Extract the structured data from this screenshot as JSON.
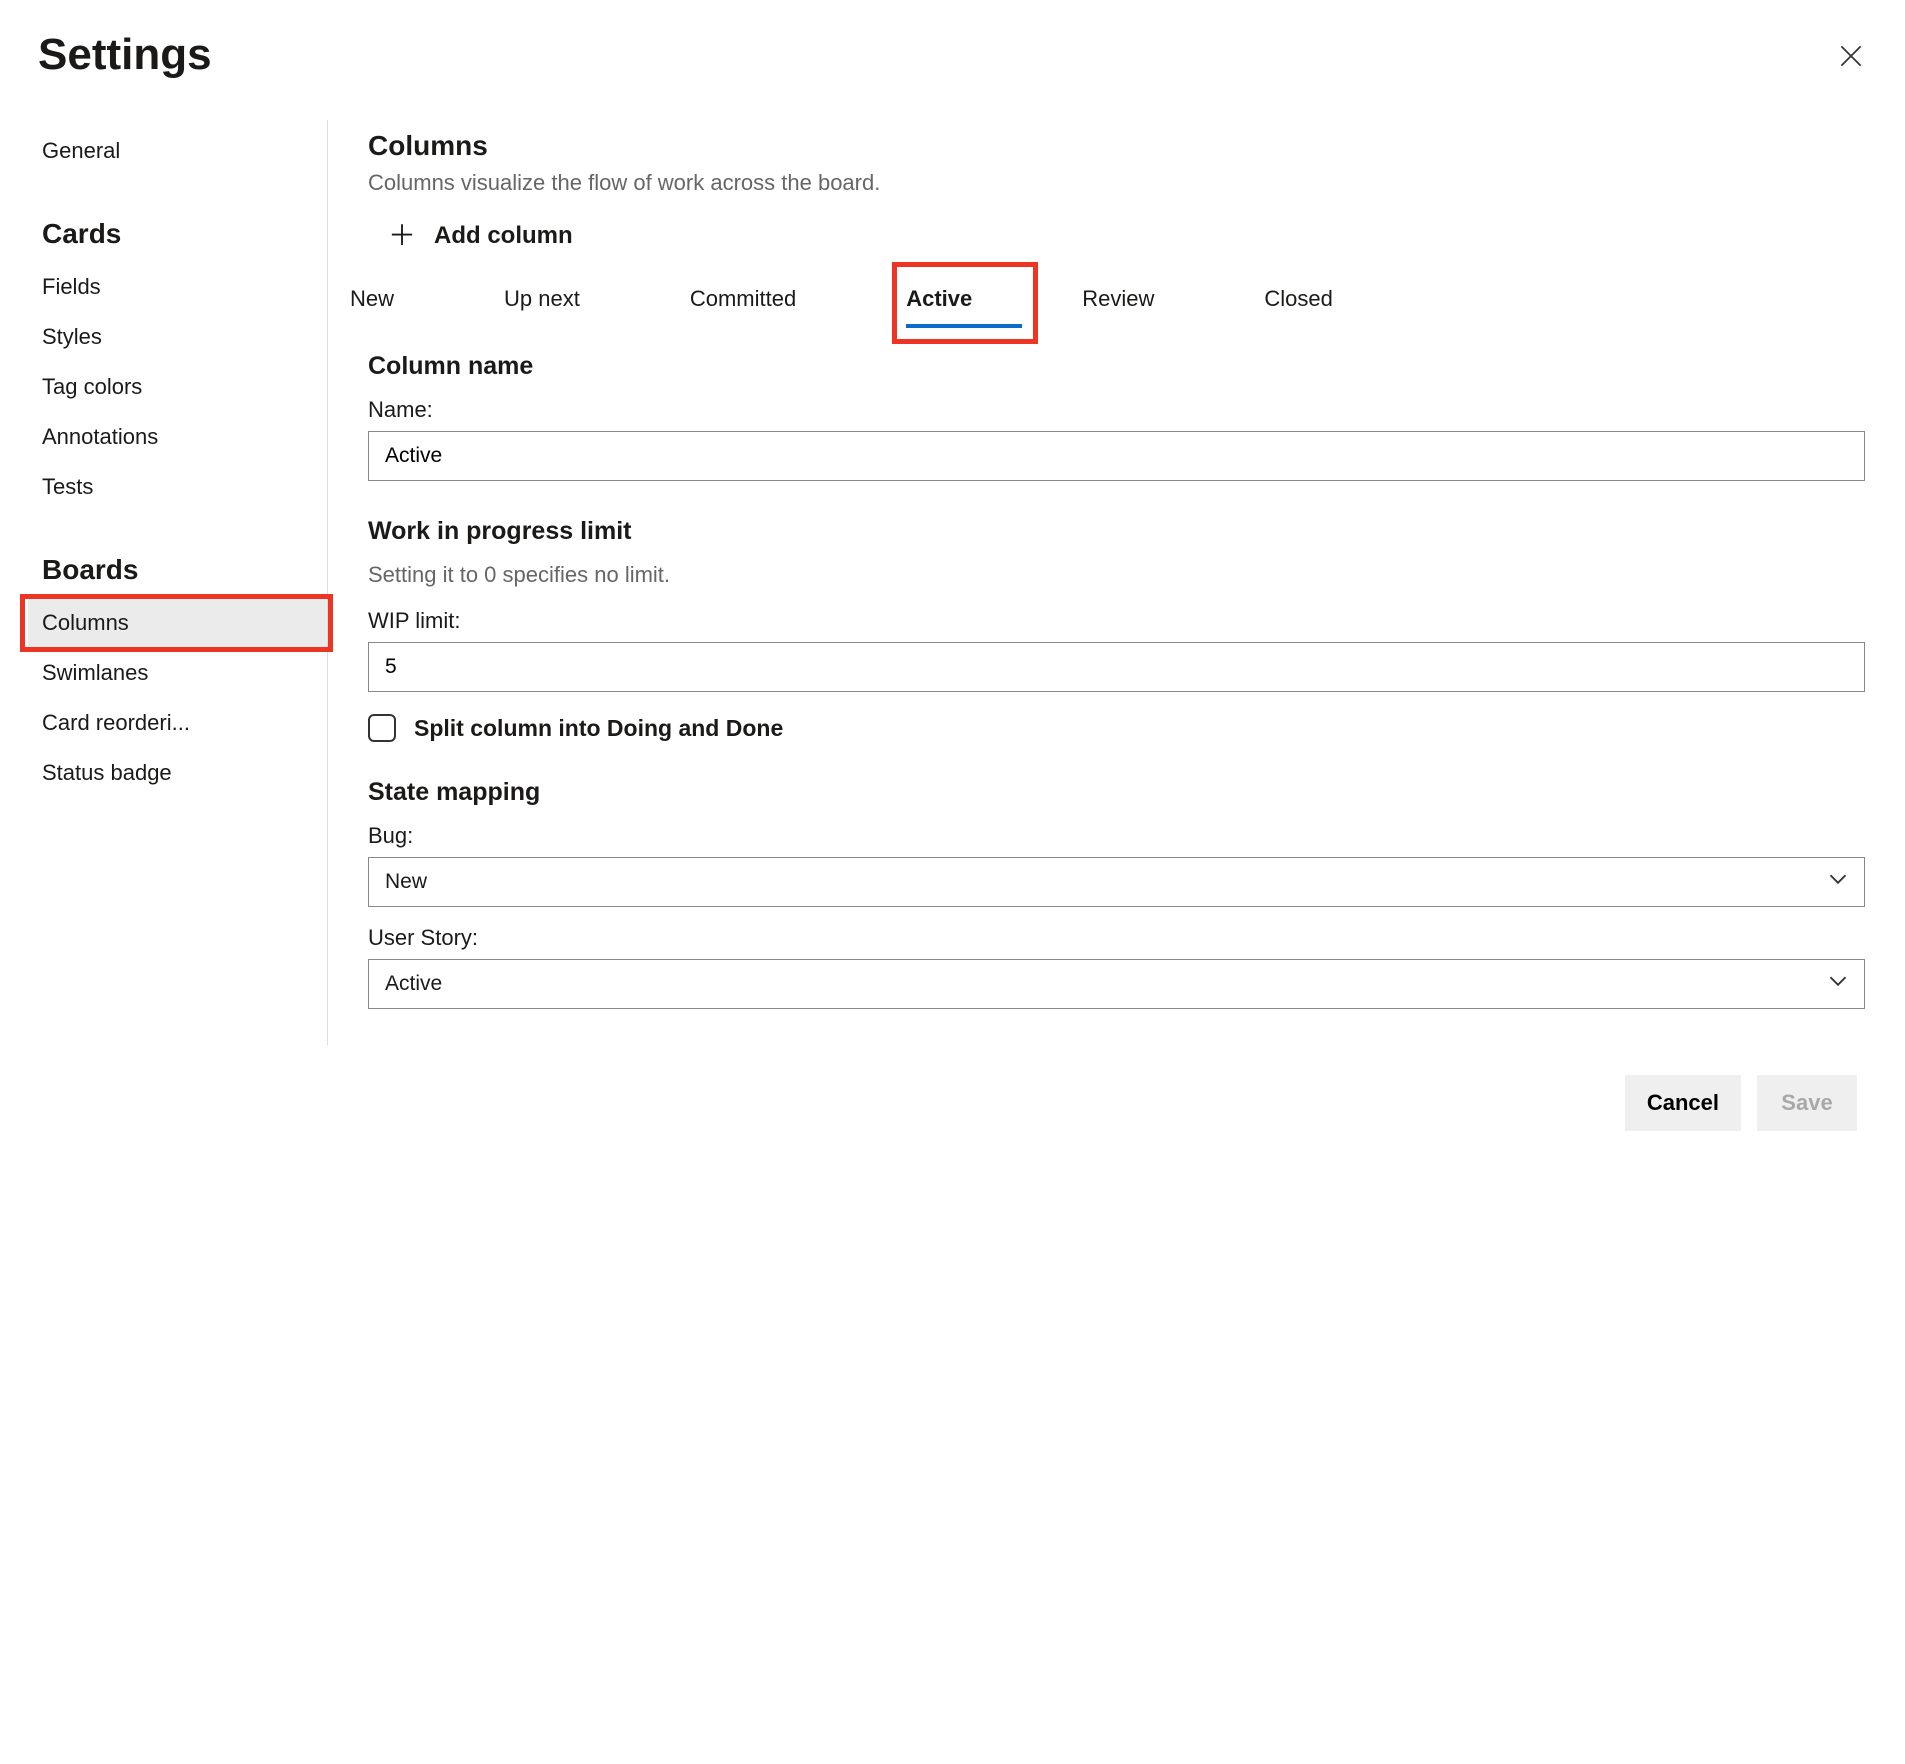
{
  "dialog": {
    "title": "Settings"
  },
  "sidebar": {
    "general": "General",
    "cards_heading": "Cards",
    "cards_items": [
      "Fields",
      "Styles",
      "Tag colors",
      "Annotations",
      "Tests"
    ],
    "boards_heading": "Boards",
    "boards_items": [
      "Columns",
      "Swimlanes",
      "Card reorderi...",
      "Status badge"
    ],
    "selected": "Columns"
  },
  "main": {
    "section_title": "Columns",
    "section_desc": "Columns visualize the flow of work across the board.",
    "add_column_label": "Add column",
    "tabs": [
      "New",
      "Up next",
      "Committed",
      "Active",
      "Review",
      "Closed"
    ],
    "active_tab": "Active",
    "column_name": {
      "heading": "Column name",
      "label": "Name:",
      "value": "Active"
    },
    "wip": {
      "heading": "Work in progress limit",
      "hint": "Setting it to 0 specifies no limit.",
      "label": "WIP limit:",
      "value": "5"
    },
    "split": {
      "label": "Split column into Doing and Done",
      "checked": false
    },
    "state_mapping": {
      "heading": "State mapping",
      "bug_label": "Bug:",
      "bug_value": "New",
      "userstory_label": "User Story:",
      "userstory_value": "Active"
    }
  },
  "footer": {
    "cancel": "Cancel",
    "save": "Save"
  }
}
